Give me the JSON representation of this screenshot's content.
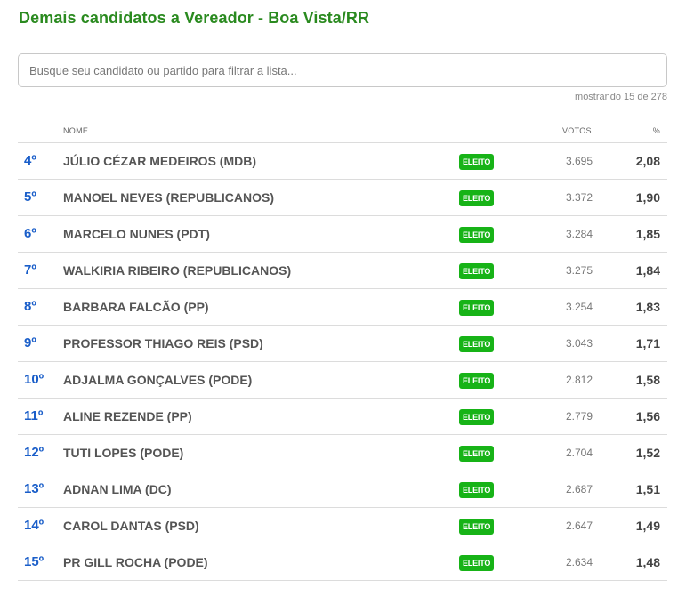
{
  "page": {
    "title": "Demais candidatos a Vereador - Boa Vista/RR"
  },
  "search": {
    "placeholder": "Busque seu candidato ou partido para filtrar a lista..."
  },
  "showing": "mostrando 15 de 278",
  "table": {
    "headers": {
      "rank": "",
      "name": "NOME",
      "votes": "VOTOS",
      "pct": "%"
    },
    "rows": [
      {
        "rank": "4º",
        "name": "JÚLIO CÉZAR MEDEIROS (MDB)",
        "status": "ELEITO",
        "votes": "3.695",
        "pct": "2,08"
      },
      {
        "rank": "5º",
        "name": "MANOEL NEVES (REPUBLICANOS)",
        "status": "ELEITO",
        "votes": "3.372",
        "pct": "1,90"
      },
      {
        "rank": "6º",
        "name": "MARCELO NUNES (PDT)",
        "status": "ELEITO",
        "votes": "3.284",
        "pct": "1,85"
      },
      {
        "rank": "7º",
        "name": "WALKIRIA RIBEIRO (REPUBLICANOS)",
        "status": "ELEITO",
        "votes": "3.275",
        "pct": "1,84"
      },
      {
        "rank": "8º",
        "name": "BARBARA FALCÃO (PP)",
        "status": "ELEITO",
        "votes": "3.254",
        "pct": "1,83"
      },
      {
        "rank": "9º",
        "name": "PROFESSOR THIAGO REIS (PSD)",
        "status": "ELEITO",
        "votes": "3.043",
        "pct": "1,71"
      },
      {
        "rank": "10º",
        "name": "ADJALMA GONÇALVES (PODE)",
        "status": "ELEITO",
        "votes": "2.812",
        "pct": "1,58"
      },
      {
        "rank": "11º",
        "name": "ALINE REZENDE (PP)",
        "status": "ELEITO",
        "votes": "2.779",
        "pct": "1,56"
      },
      {
        "rank": "12º",
        "name": "TUTI LOPES (PODE)",
        "status": "ELEITO",
        "votes": "2.704",
        "pct": "1,52"
      },
      {
        "rank": "13º",
        "name": "ADNAN LIMA (DC)",
        "status": "ELEITO",
        "votes": "2.687",
        "pct": "1,51"
      },
      {
        "rank": "14º",
        "name": "CAROL DANTAS (PSD)",
        "status": "ELEITO",
        "votes": "2.647",
        "pct": "1,49"
      },
      {
        "rank": "15º",
        "name": "PR GILL ROCHA (PODE)",
        "status": "ELEITO",
        "votes": "2.634",
        "pct": "1,48"
      }
    ]
  },
  "colors": {
    "title": "#2a8a1f",
    "rank": "#1a5ec9",
    "badge": "#17b317"
  }
}
